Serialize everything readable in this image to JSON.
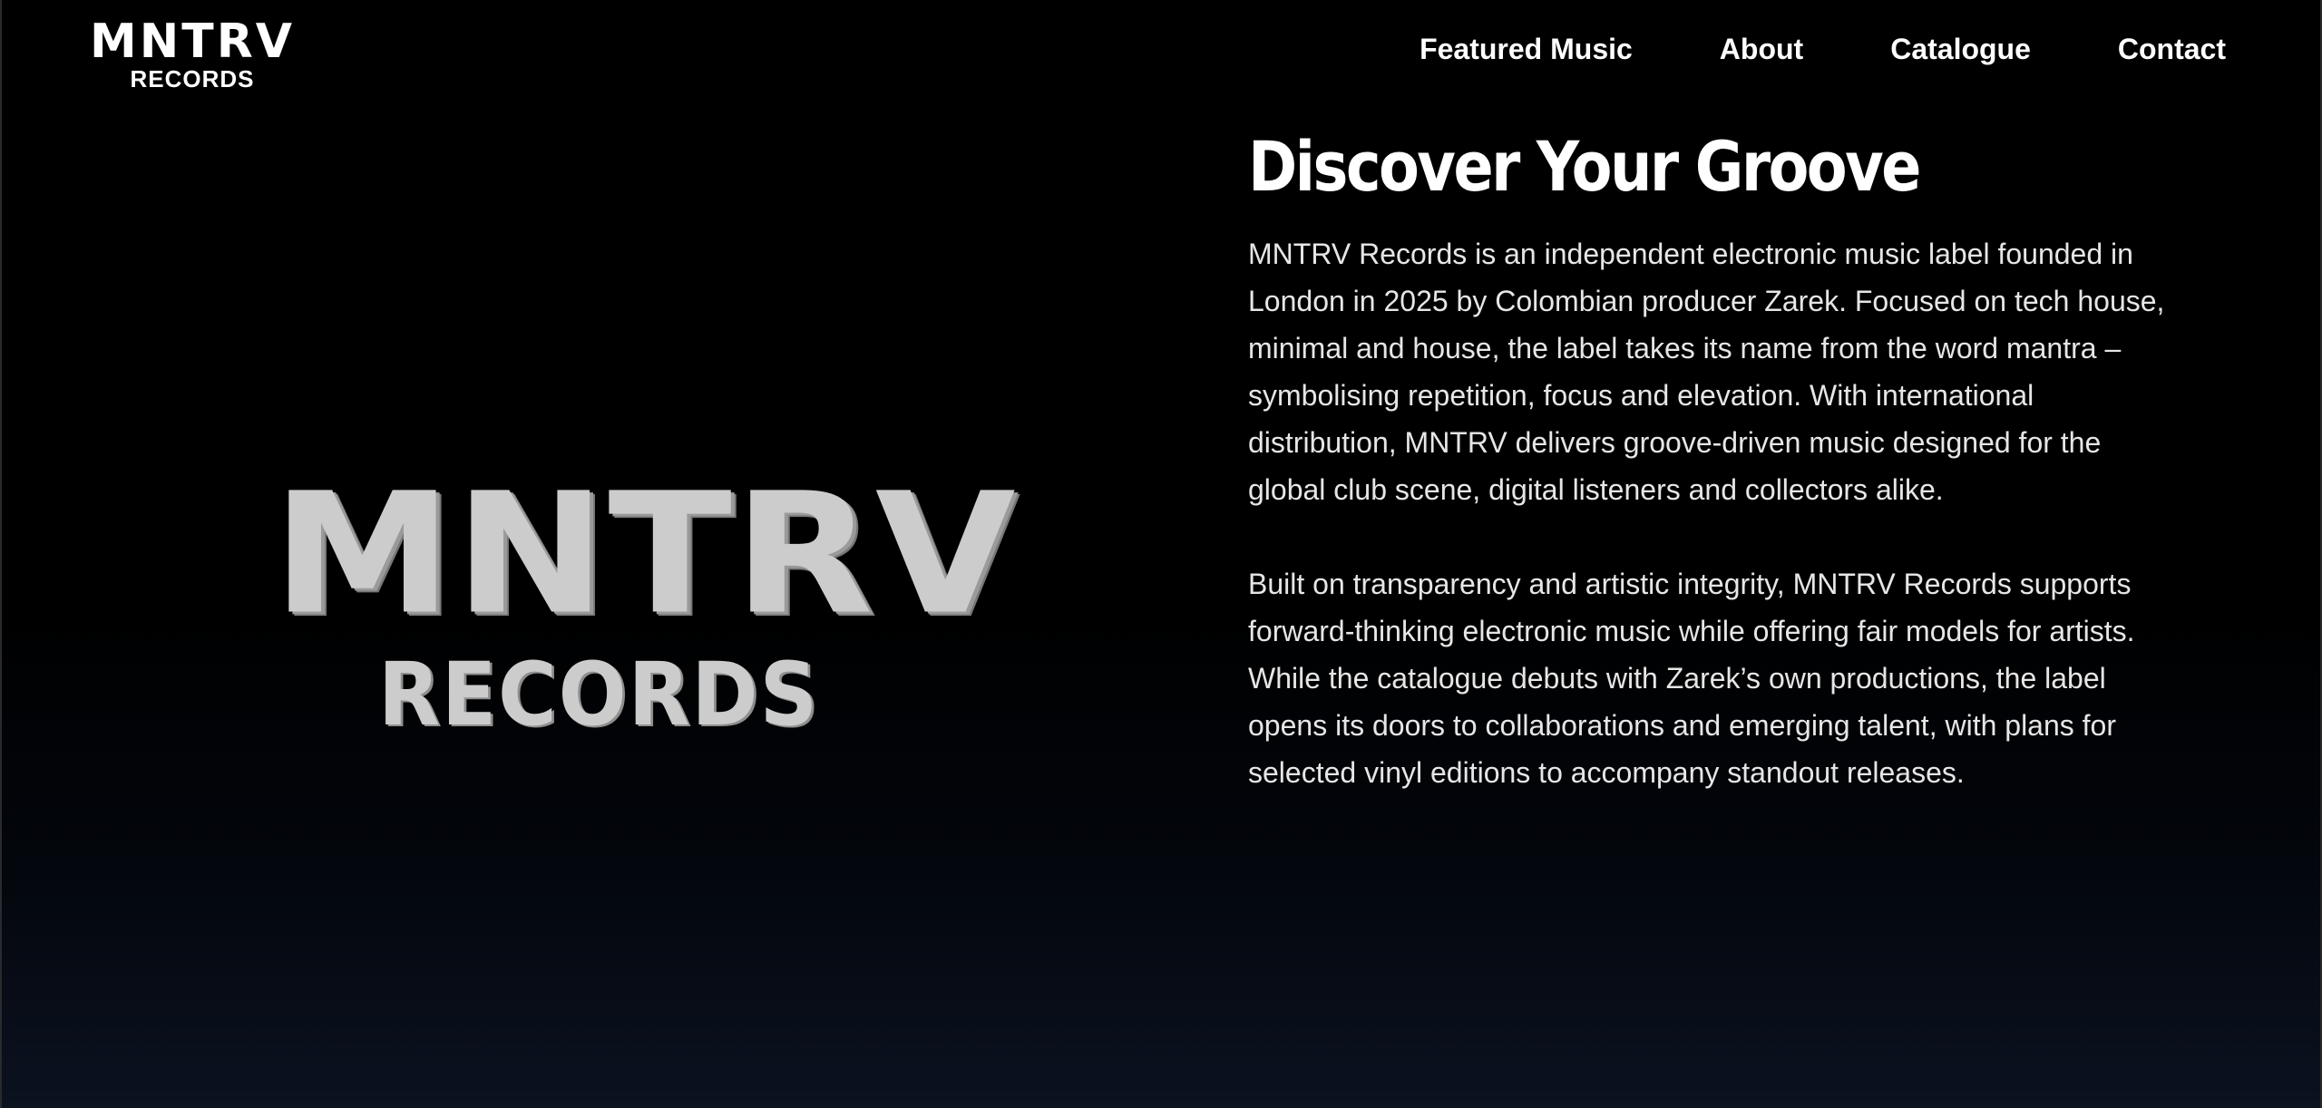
{
  "header": {
    "brand": {
      "main": "MNTRV",
      "sub": "RECORDS"
    },
    "nav": [
      {
        "label": "Featured Music"
      },
      {
        "label": "About"
      },
      {
        "label": "Catalogue"
      },
      {
        "label": "Contact"
      }
    ]
  },
  "hero": {
    "logo_main": "MNTRV",
    "logo_sub": "RECORDS"
  },
  "about": {
    "title": "Discover Your Groove",
    "paragraphs": [
      "MNTRV Records is an independent electronic music label founded in London in 2025 by Colombian producer Zarek. Focused on tech house, minimal and house, the label takes its name from the word mantra – symbolising repetition, focus and elevation. With international distribution, MNTRV delivers groove-driven music designed for the global club scene, digital listeners and collectors alike.",
      "Built on transparency and artistic integrity, MNTRV Records supports forward-thinking electronic music while offering fair models for artists. While the catalogue debuts with Zarek’s own productions, the label opens its doors to collaborations and emerging talent, with plans for selected vinyl editions to accompany standout releases."
    ]
  },
  "colors": {
    "background": "#000000",
    "background_bottom": "#0b1220",
    "text": "#ffffff",
    "body_text": "#e6e6e6",
    "logo_gray": "#cccccc"
  }
}
